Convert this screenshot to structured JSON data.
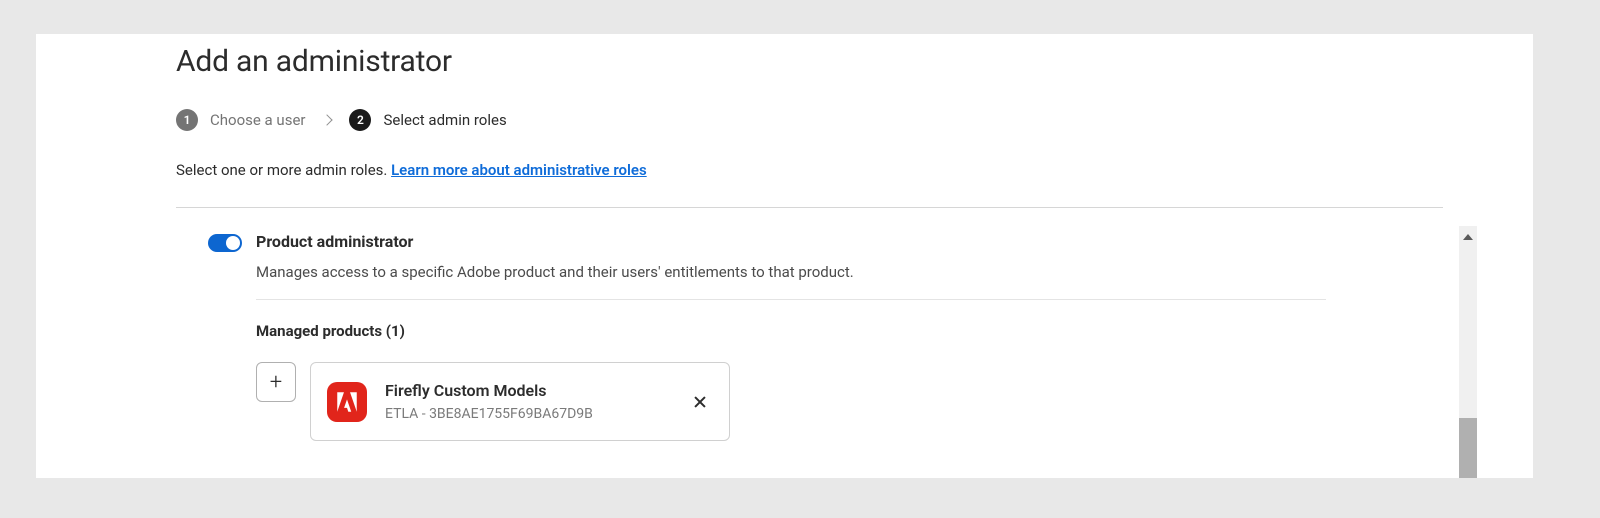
{
  "page_title": "Add an administrator",
  "steps": [
    {
      "n": "1",
      "label": "Choose a user"
    },
    {
      "n": "2",
      "label": "Select admin roles"
    }
  ],
  "helper_text": "Select one or more admin roles. ",
  "helper_link": "Learn more about administrative roles",
  "role": {
    "title": "Product administrator",
    "desc": "Manages access to a specific Adobe product and their users' entitlements to that product.",
    "managed_heading": "Managed products (1)"
  },
  "product": {
    "name": "Firefly Custom Models",
    "sub": "ETLA - 3BE8AE1755F69BA67D9B"
  }
}
